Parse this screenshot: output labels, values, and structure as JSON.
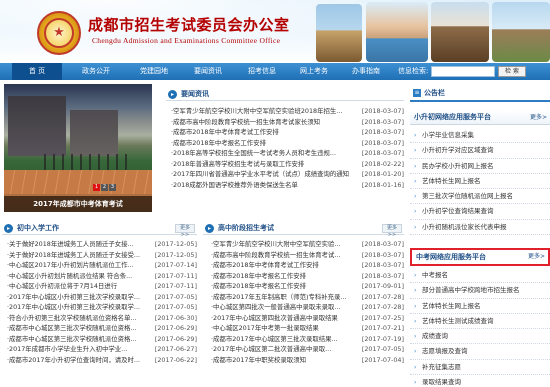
{
  "header": {
    "title": "成都市招生考试委员会办公室",
    "subtitle": "Chengdu Admission and Examinations Committee Office"
  },
  "nav": {
    "items": [
      "首 页",
      "政务公开",
      "党建园地",
      "要闻资讯",
      "招考信息",
      "网上考务",
      "办事指南"
    ],
    "search_label": "信息检索:",
    "search_placeholder": "",
    "search_button": "检 索"
  },
  "slider": {
    "caption": "2017年成都市中考体育考试",
    "dots": [
      "1",
      "2",
      "3"
    ]
  },
  "news": {
    "title": "要闻资讯",
    "more": "更多>>",
    "items": [
      {
        "title": "·空军青少年航空学校川大附中空军航空实验班2018年招生...",
        "date": "[2018-03-07]"
      },
      {
        "title": "·成都市高中阶段教育学校统一招生体育考试家长须知",
        "date": "[2018-03-07]"
      },
      {
        "title": "·成都市2018年中考体育考试工作安排",
        "date": "[2018-03-07]"
      },
      {
        "title": "·成都市2018年中考报名工作安排",
        "date": "[2018-03-07]"
      },
      {
        "title": "·2018年高等学校招生全国统一考试考务人员和考生违规...",
        "date": "[2018-03-07]"
      },
      {
        "title": "·2018年普通高等学校招生考试与录取工作安排",
        "date": "[2018-02-22]"
      },
      {
        "title": "·2017年四川省普通高中学业水平考试（试点）成绩查询的通知",
        "date": "[2018-01-20]"
      },
      {
        "title": "·2018成都外国语学校推荐外语类保送生名单",
        "date": "[2018-01-16]"
      }
    ]
  },
  "primary": {
    "title": "初中入学工作",
    "more": "更多>>",
    "items": [
      {
        "title": "·关于做好2018年进城务工人员随迁子女接...",
        "date": "[2017-12-05]"
      },
      {
        "title": "·关于做好2018年进城务工人员随迁子女接受...",
        "date": "[2017-12-05]"
      },
      {
        "title": "·中心城区2017年小升初划片随机派位工作...",
        "date": "[2017-07-14]"
      },
      {
        "title": "·中心城区小升初划片随机派位结果 符合条...",
        "date": "[2017-07-11]"
      },
      {
        "title": "·中心城区小升初派位将于7月14日进行",
        "date": "[2017-07-11]"
      },
      {
        "title": "·2017年中心城区小升初第三批次学校录取学...",
        "date": "[2017-07-05]"
      },
      {
        "title": "·2017年中心城区小升初第三批次学校录取学...",
        "date": "[2017-07-05]"
      },
      {
        "title": "·符合小升初第三批次学校随机派位资格名单...",
        "date": "[2017-06-30]"
      },
      {
        "title": "·成都市中心城区第三批次学校随机派位资格...",
        "date": "[2017-06-29]"
      },
      {
        "title": "·成都市中心城区第三批次学校随机派位资格...",
        "date": "[2017-06-29]"
      },
      {
        "title": "·2017年成都市小学毕业生升入初中学业...",
        "date": "[2017-06-27]"
      },
      {
        "title": "·成都市2017年小升初学位查询时间，请及时...",
        "date": "[2017-06-22]"
      }
    ]
  },
  "highschool": {
    "title": "高中阶段招生考试",
    "more": "更多>>",
    "items": [
      {
        "title": "·空军青少年航空学校川大附中空军航空实验...",
        "date": "[2018-03-07]"
      },
      {
        "title": "·成都市高中阶段教育学校统一招生体育考试...",
        "date": "[2018-03-07]"
      },
      {
        "title": "·成都市2018年中考体育考试工作安排",
        "date": "[2018-03-07]"
      },
      {
        "title": "·成都市2018年中考报名工作安排",
        "date": "[2018-03-07]"
      },
      {
        "title": "·成都市2018年中考报名工作安排",
        "date": "[2017-09-01]"
      },
      {
        "title": "·成都市2017年五年制高职（师范)专科补充录...",
        "date": "[2017-07-28]"
      },
      {
        "title": "·中心城区第四批次一般普通高中录取未录取...",
        "date": "[2017-07-28]"
      },
      {
        "title": "·2017年中心城区第四批次普通高中录取结果",
        "date": "[2017-07-25]"
      },
      {
        "title": "·中心城区2017年中考第一批录取结果",
        "date": "[2017-07-21]"
      },
      {
        "title": "·成都市2017年中心城区第三批次录取结果...",
        "date": "[2017-07-19]"
      },
      {
        "title": "·2017年中心城区第二批次普通高中录取...",
        "date": "[2017-07-05]"
      },
      {
        "title": "·成都市2017年中职奖校录取须知",
        "date": "[2017-07-04]"
      }
    ]
  },
  "sidebar": {
    "announce_title": "公告栏",
    "panel1": {
      "title": "小升初网络应用服务平台",
      "more": "更多>",
      "items": [
        "小学毕业信息采集",
        "小升初升学对应区域查询",
        "民办学校小升初网上报名",
        "艺体特长生网上报名",
        "第三批次学位随机派位网上报名",
        "小升初学位查询结果查询",
        "小升初随机派位家长代表申报"
      ]
    },
    "panel2": {
      "title": "中考网络应用服务平台",
      "more": "更多>",
      "items": [
        "中考报名",
        "部分普通高中学校跨地市招生报名",
        "艺体特长生网上报名",
        "艺体特长生测试成绩查询",
        "成绩查询",
        "志愿填报及查询",
        "补充征集志愿",
        "录取结果查询"
      ]
    }
  }
}
